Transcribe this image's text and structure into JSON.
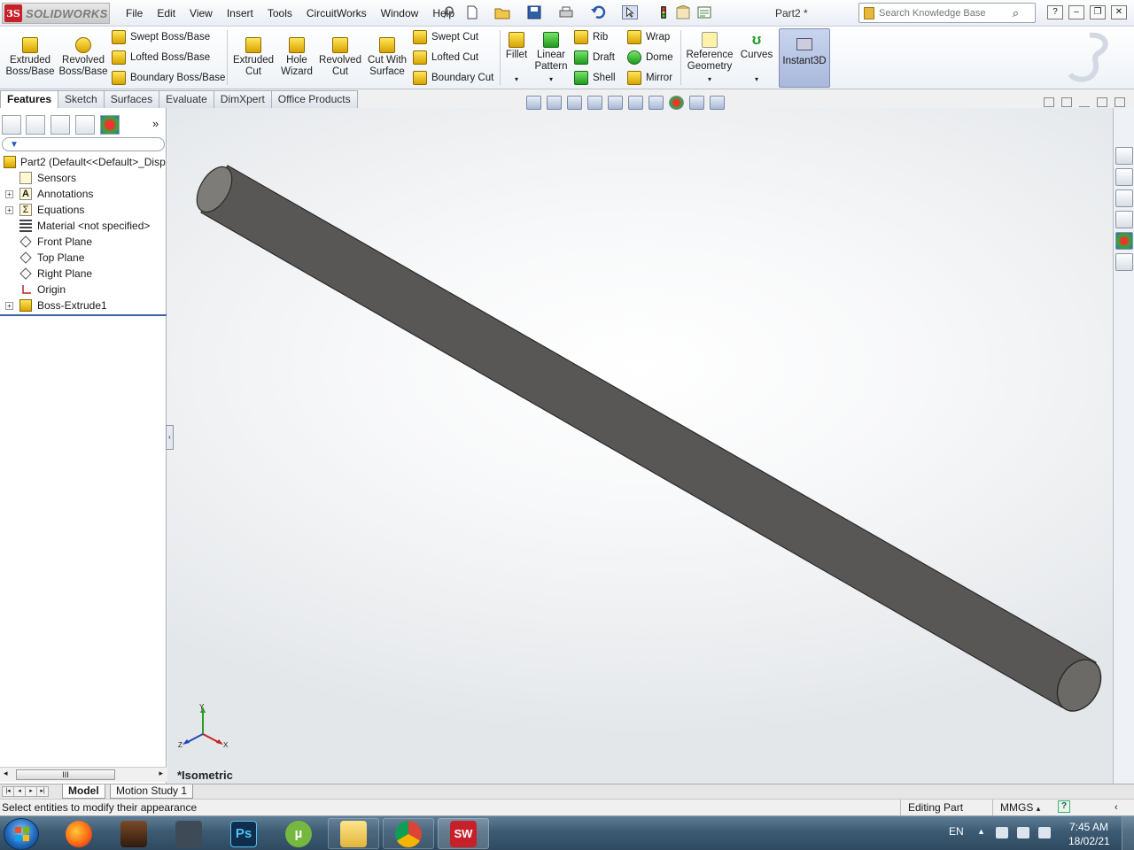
{
  "app": {
    "logo_prefix": "3S",
    "logo_text": "SOLIDWORKS",
    "document_title": "Part2 *",
    "menu": [
      "File",
      "Edit",
      "View",
      "Insert",
      "Tools",
      "CircuitWorks",
      "Window",
      "Help"
    ],
    "search_placeholder": "Search Knowledge Base"
  },
  "ribbon": {
    "extruded_boss": "Extruded Boss/Base",
    "revolved_boss": "Revolved Boss/Base",
    "swept_boss": "Swept Boss/Base",
    "lofted_boss": "Lofted Boss/Base",
    "boundary_boss": "Boundary Boss/Base",
    "extruded_cut": "Extruded Cut",
    "hole_wizard": "Hole Wizard",
    "revolved_cut": "Revolved Cut",
    "cut_with_surface": "Cut With Surface",
    "swept_cut": "Swept Cut",
    "lofted_cut": "Lofted Cut",
    "boundary_cut": "Boundary Cut",
    "fillet": "Fillet",
    "linear_pattern": "Linear Pattern",
    "rib": "Rib",
    "draft": "Draft",
    "shell": "Shell",
    "wrap": "Wrap",
    "dome": "Dome",
    "mirror": "Mirror",
    "reference_geometry": "Reference Geometry",
    "curves": "Curves",
    "instant3d": "Instant3D"
  },
  "command_tabs": [
    "Features",
    "Sketch",
    "Surfaces",
    "Evaluate",
    "DimXpert",
    "Office Products"
  ],
  "tree": {
    "root": "Part2  (Default<<Default>_Disp",
    "items": [
      {
        "label": "Sensors",
        "expandable": false
      },
      {
        "label": "Annotations",
        "expandable": true
      },
      {
        "label": "Equations",
        "expandable": true
      },
      {
        "label": "Material <not specified>",
        "expandable": false
      },
      {
        "label": "Front Plane",
        "expandable": false
      },
      {
        "label": "Top Plane",
        "expandable": false
      },
      {
        "label": "Right Plane",
        "expandable": false
      },
      {
        "label": "Origin",
        "expandable": false
      },
      {
        "label": "Boss-Extrude1",
        "expandable": true
      }
    ]
  },
  "scroll_thumb_label": "III",
  "viewport": {
    "view_name": "*Isometric",
    "triad_labels": {
      "x": "X",
      "y": "Y",
      "z": "Z"
    },
    "part_color": "#6e6c69"
  },
  "bottom_tabs": [
    "Model",
    "Motion Study 1"
  ],
  "status": {
    "message": "Select entities to modify their appearance",
    "mode": "Editing Part",
    "units": "MMGS",
    "units_arrow": "▴",
    "help_icon": "?"
  },
  "taskbar": {
    "apps": [
      "firefox",
      "game",
      "counter-strike",
      "photoshop",
      "utorrent",
      "file-explorer",
      "chrome",
      "solidworks"
    ],
    "photoshop_label": "Ps",
    "utorrent_label": "µ",
    "solidworks_label": "SW",
    "language": "EN",
    "time": "7:45 AM",
    "date": "18/02/21"
  }
}
